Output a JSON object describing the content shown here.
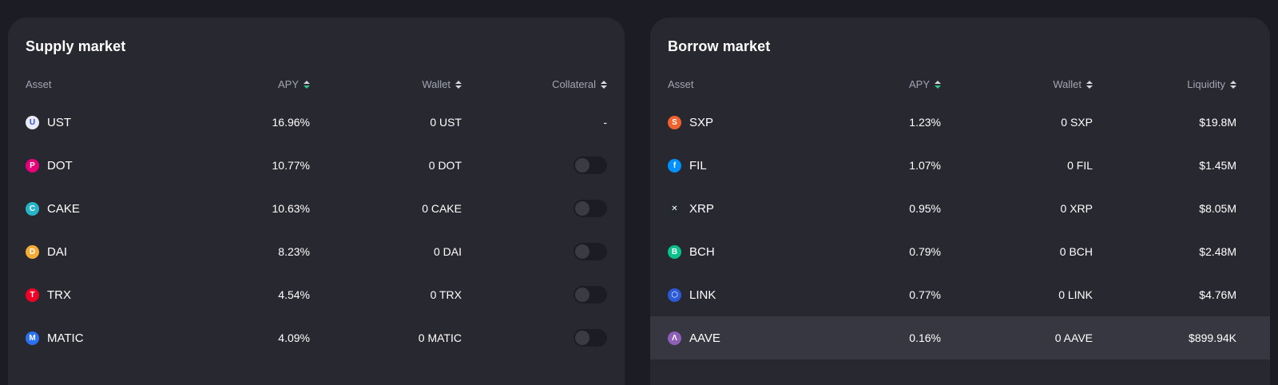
{
  "supply": {
    "title": "Supply market",
    "headers": {
      "asset": "Asset",
      "apy": "APY",
      "wallet": "Wallet",
      "collateral": "Collateral"
    },
    "rows": [
      {
        "symbol": "UST",
        "apy": "16.96%",
        "wallet": "0 UST",
        "collateral": "-",
        "icon": "ust-icon",
        "color": "#e8eaf5"
      },
      {
        "symbol": "DOT",
        "apy": "10.77%",
        "wallet": "0 DOT",
        "collateral": "toggle",
        "icon": "dot-icon",
        "color": "#e6007a"
      },
      {
        "symbol": "CAKE",
        "apy": "10.63%",
        "wallet": "0 CAKE",
        "collateral": "toggle",
        "icon": "cake-icon",
        "color": "#28b4c8"
      },
      {
        "symbol": "DAI",
        "apy": "8.23%",
        "wallet": "0 DAI",
        "collateral": "toggle",
        "icon": "dai-icon",
        "color": "#f5ac37"
      },
      {
        "symbol": "TRX",
        "apy": "4.54%",
        "wallet": "0 TRX",
        "collateral": "toggle",
        "icon": "trx-icon",
        "color": "#ef0027"
      },
      {
        "symbol": "MATIC",
        "apy": "4.09%",
        "wallet": "0 MATIC",
        "collateral": "toggle",
        "icon": "matic-icon",
        "color": "#2a71f5"
      }
    ]
  },
  "borrow": {
    "title": "Borrow market",
    "headers": {
      "asset": "Asset",
      "apy": "APY",
      "wallet": "Wallet",
      "liquidity": "Liquidity"
    },
    "rows": [
      {
        "symbol": "SXP",
        "apy": "1.23%",
        "wallet": "0 SXP",
        "liquidity": "$19.8M",
        "icon": "sxp-icon",
        "color": "#f2622e"
      },
      {
        "symbol": "FIL",
        "apy": "1.07%",
        "wallet": "0 FIL",
        "liquidity": "$1.45M",
        "icon": "fil-icon",
        "color": "#0090ff"
      },
      {
        "symbol": "XRP",
        "apy": "0.95%",
        "wallet": "0 XRP",
        "liquidity": "$8.05M",
        "icon": "xrp-icon",
        "color": "#23292f"
      },
      {
        "symbol": "BCH",
        "apy": "0.79%",
        "wallet": "0 BCH",
        "liquidity": "$2.48M",
        "icon": "bch-icon",
        "color": "#0ac18e"
      },
      {
        "symbol": "LINK",
        "apy": "0.77%",
        "wallet": "0 LINK",
        "liquidity": "$4.76M",
        "icon": "link-icon",
        "color": "#2a5ada"
      },
      {
        "symbol": "AAVE",
        "apy": "0.16%",
        "wallet": "0 AAVE",
        "liquidity": "$899.94K",
        "icon": "aave-icon",
        "color": "#8e5fb8"
      }
    ]
  }
}
